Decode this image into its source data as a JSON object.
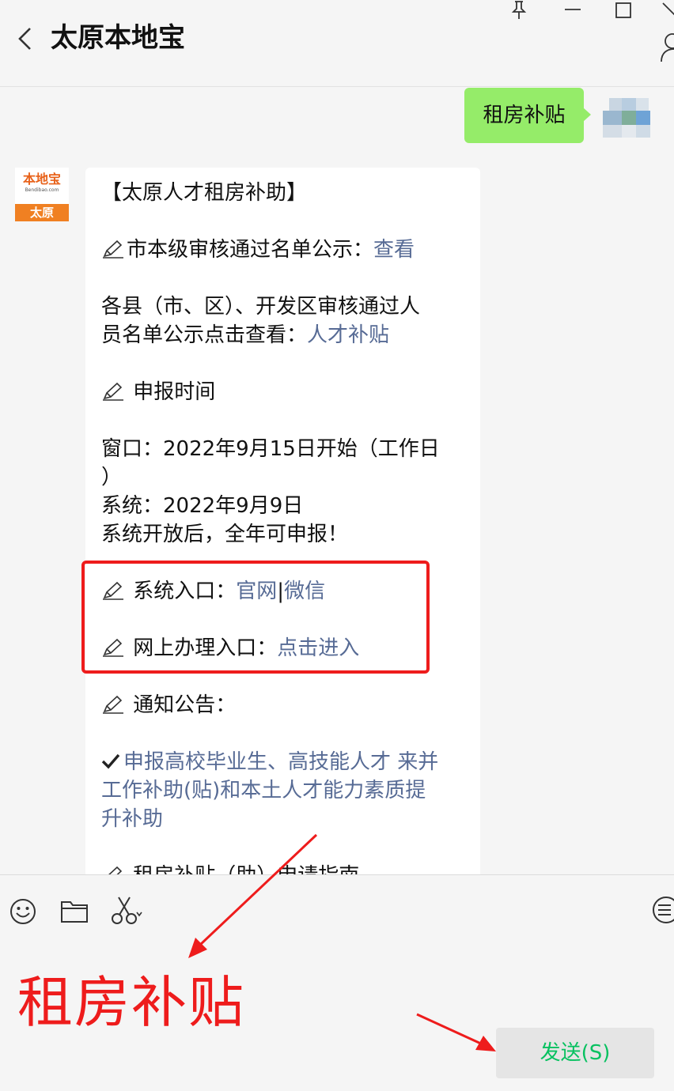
{
  "header": {
    "title": "太原本地宝",
    "icons": [
      "back-icon",
      "pin-icon",
      "minimize-icon",
      "maximize-icon",
      "close-icon",
      "profile-icon"
    ]
  },
  "chat": {
    "sent_message": "租房补贴",
    "logo": {
      "name": "本地宝",
      "site": "Bendibao.com",
      "city": "太原"
    },
    "reply": {
      "title": "【太原人才租房补助】",
      "line1_text": "市本级审核通过名单公示：",
      "line1_link": "查看",
      "line2a": "各县（市、区）、开发区审核通过人",
      "line2b_text": "员名单公示点击查看：",
      "line2b_link": "人才补贴",
      "apply_time": "申报时间",
      "window_a": "窗口：2022年9月15日开始（工作日",
      "window_b": "）",
      "system_date": "系统：2022年9月9日",
      "system_open": "系统开放后，全年可申报！",
      "entry_label": "系统入口：",
      "entry_link1": "官网",
      "entry_sep": "|",
      "entry_link2": "微信",
      "online_label": "网上办理入口：",
      "online_link": "点击进入",
      "notice": "通知公告：",
      "notice_link_a": "申报高校毕业生、高技能人才 来并",
      "notice_link_b": "工作补助(贴)和本土人才能力素质提",
      "notice_link_c": "升补助",
      "guide_partial": "租房补贴（助）申请指南"
    }
  },
  "input": {
    "typed_text": "租房补贴",
    "send_label": "发送(S)",
    "icons": [
      "emoji-icon",
      "folder-icon",
      "scissors-icon",
      "chat-history-icon"
    ]
  },
  "colors": {
    "sent_bubble": "#95ec69",
    "link": "#576b95",
    "annotation_red": "#ee1c1c",
    "send_text": "#07c160"
  }
}
